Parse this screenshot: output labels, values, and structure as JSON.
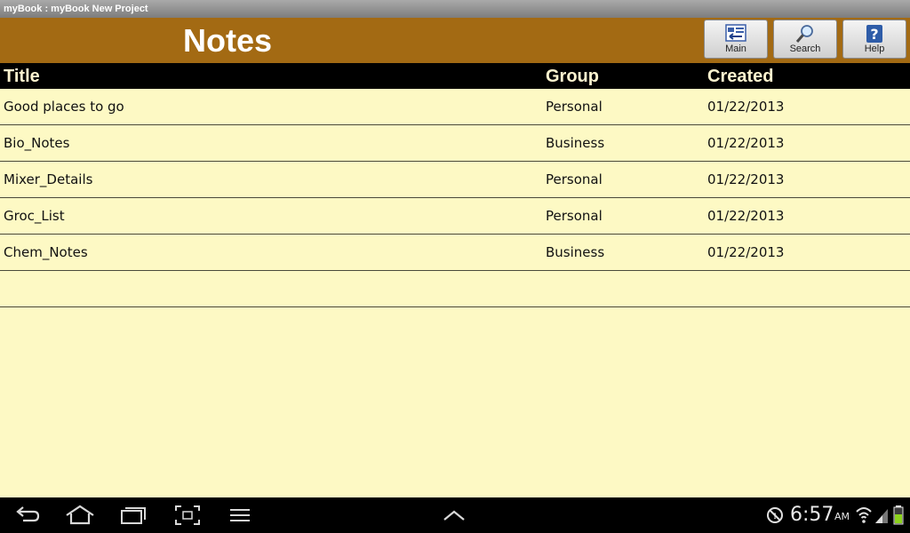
{
  "window": {
    "title": "myBook : myBook New Project"
  },
  "header": {
    "title": "Notes",
    "buttons": [
      {
        "label": "Main",
        "icon": "main-icon"
      },
      {
        "label": "Search",
        "icon": "search-icon"
      },
      {
        "label": "Help",
        "icon": "help-icon"
      }
    ]
  },
  "table": {
    "columns": [
      "Title",
      "Group",
      "Created"
    ],
    "rows": [
      {
        "title": "Good places to go",
        "group": "Personal",
        "created": "01/22/2013"
      },
      {
        "title": "Bio_Notes",
        "group": "Business",
        "created": "01/22/2013"
      },
      {
        "title": "Mixer_Details",
        "group": "Personal",
        "created": "01/22/2013"
      },
      {
        "title": "Groc_List",
        "group": "Personal",
        "created": "01/22/2013"
      },
      {
        "title": "Chem_Notes",
        "group": "Business",
        "created": "01/22/2013"
      },
      {
        "title": "",
        "group": "",
        "created": ""
      }
    ]
  },
  "status_bar": {
    "time": "6:57",
    "ampm": "AM",
    "icons": [
      "back-icon",
      "home-icon",
      "recent-apps-icon",
      "screenshot-icon",
      "menu-icon",
      "up-arrow-icon",
      "no-data-icon",
      "wifi-icon",
      "signal-icon",
      "battery-icon"
    ]
  },
  "colors": {
    "header_bg": "#a36a13",
    "background": "#fdf9c4",
    "column_header_bg": "#000000",
    "column_header_text": "#fdf3cf"
  }
}
